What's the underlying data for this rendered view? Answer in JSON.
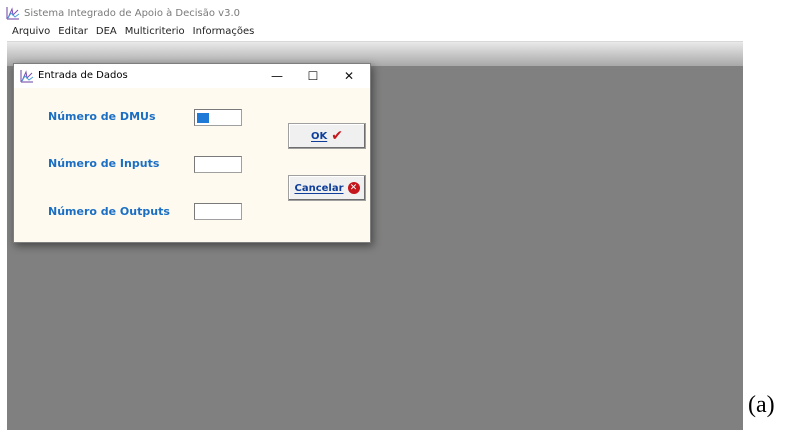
{
  "app": {
    "title": "Sistema Integrado de Apoio à Decisão v3.0",
    "icon": "chart-logo-icon"
  },
  "menu": [
    "Arquivo",
    "Editar",
    "DEA",
    "Multicriterio",
    "Informações"
  ],
  "dialog": {
    "title": "Entrada de Dados",
    "icon": "chart-logo-icon",
    "controls": {
      "minimize": "—",
      "maximize": "☐",
      "close": "✕"
    },
    "fields": [
      {
        "label": "Número de DMUs",
        "value": ""
      },
      {
        "label": "Número de Inputs",
        "value": ""
      },
      {
        "label": "Número de Outputs",
        "value": ""
      }
    ],
    "buttons": {
      "ok": {
        "label": "OK",
        "icon": "checkmark-icon"
      },
      "cancel": {
        "label": "Cancelar",
        "icon": "cancel-icon"
      }
    }
  },
  "caption": "(a)",
  "colors": {
    "workspace": "#808080",
    "dialog_background": "#fffaf0",
    "label_text": "#1a6fc4",
    "button_text": "#0f3e9a",
    "icon_red": "#c4161c"
  }
}
